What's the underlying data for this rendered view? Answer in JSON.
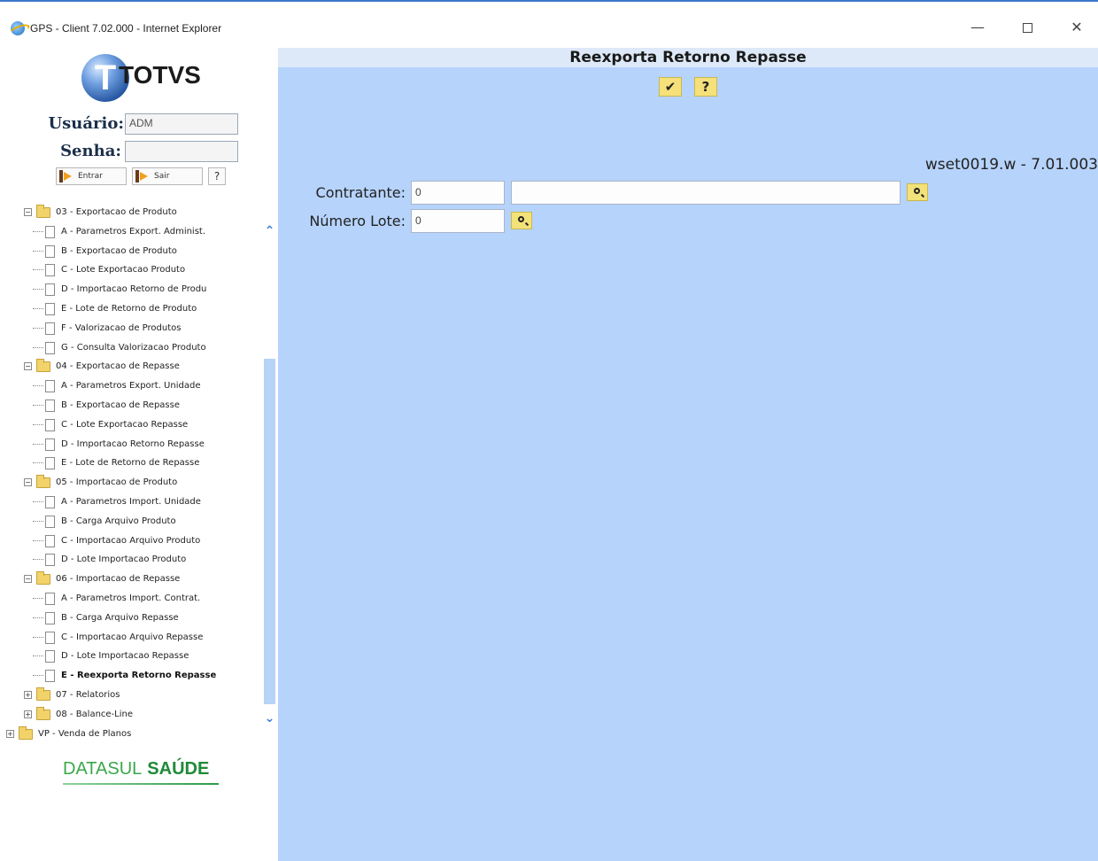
{
  "window": {
    "title": "GPS - Client 7.02.000 - Internet Explorer",
    "minimize": "—",
    "close": "✕"
  },
  "sidebar": {
    "logo_text": "TOTVS",
    "logo_letter": "T",
    "user_label": "Usuário:",
    "user_value": "ADM",
    "password_label": "Senha:",
    "password_value": "",
    "enter_label": "Entrar",
    "exit_label": "Sair",
    "help_label": "?",
    "tree": [
      {
        "indent": 1,
        "type": "folder",
        "expander": "−",
        "label": "03 - Exportacao de Produto",
        "bold": false
      },
      {
        "indent": 2,
        "type": "doc",
        "label": "A - Parametros Export. Administ.",
        "bold": false
      },
      {
        "indent": 2,
        "type": "doc",
        "label": "B - Exportacao de Produto",
        "bold": false
      },
      {
        "indent": 2,
        "type": "doc",
        "label": "C - Lote Exportacao Produto",
        "bold": false
      },
      {
        "indent": 2,
        "type": "doc",
        "label": "D - Importacao Retorno de Produ",
        "bold": false
      },
      {
        "indent": 2,
        "type": "doc",
        "label": "E - Lote de Retorno de Produto",
        "bold": false
      },
      {
        "indent": 2,
        "type": "doc",
        "label": "F - Valorizacao de Produtos",
        "bold": false
      },
      {
        "indent": 2,
        "type": "doc",
        "label": "G - Consulta Valorizacao Produto",
        "bold": false
      },
      {
        "indent": 1,
        "type": "folder",
        "expander": "−",
        "label": "04 - Exportacao de Repasse",
        "bold": false
      },
      {
        "indent": 2,
        "type": "doc",
        "label": "A - Parametros Export. Unidade",
        "bold": false
      },
      {
        "indent": 2,
        "type": "doc",
        "label": "B - Exportacao de Repasse",
        "bold": false
      },
      {
        "indent": 2,
        "type": "doc",
        "label": "C - Lote Exportacao Repasse",
        "bold": false
      },
      {
        "indent": 2,
        "type": "doc",
        "label": "D - Importacao Retorno Repasse",
        "bold": false
      },
      {
        "indent": 2,
        "type": "doc",
        "label": "E - Lote de Retorno de Repasse",
        "bold": false
      },
      {
        "indent": 1,
        "type": "folder",
        "expander": "−",
        "label": "05 - Importacao de Produto",
        "bold": false
      },
      {
        "indent": 2,
        "type": "doc",
        "label": "A - Parametros Import. Unidade",
        "bold": false
      },
      {
        "indent": 2,
        "type": "doc",
        "label": "B - Carga Arquivo Produto",
        "bold": false
      },
      {
        "indent": 2,
        "type": "doc",
        "label": "C - Importacao Arquivo Produto",
        "bold": false
      },
      {
        "indent": 2,
        "type": "doc",
        "label": "D - Lote Importacao Produto",
        "bold": false
      },
      {
        "indent": 1,
        "type": "folder",
        "expander": "−",
        "label": "06 - Importacao de Repasse",
        "bold": false
      },
      {
        "indent": 2,
        "type": "doc",
        "label": "A - Parametros Import. Contrat.",
        "bold": false
      },
      {
        "indent": 2,
        "type": "doc",
        "label": "B - Carga Arquivo Repasse",
        "bold": false
      },
      {
        "indent": 2,
        "type": "doc",
        "label": "C - Importacao Arquivo Repasse",
        "bold": false
      },
      {
        "indent": 2,
        "type": "doc",
        "label": "D - Lote Importacao Repasse",
        "bold": false
      },
      {
        "indent": 2,
        "type": "doc",
        "label": "E - Reexporta Retorno Repasse",
        "bold": true
      },
      {
        "indent": 1,
        "type": "folder",
        "expander": "+",
        "label": "07 - Relatorios",
        "bold": false
      },
      {
        "indent": 1,
        "type": "folder",
        "expander": "+",
        "label": "08 - Balance-Line",
        "bold": false
      },
      {
        "indent": 0,
        "type": "folder",
        "expander": "+",
        "label": "VP - Venda de Planos",
        "bold": false
      }
    ],
    "brand_left": "DATASUL",
    "brand_right": "SAÚDE"
  },
  "main": {
    "page_title": "Reexporta Retorno Repasse",
    "confirm_icon": "✔",
    "help_icon": "?",
    "version": "wset0019.w - 7.01.003",
    "contratante_label": "Contratante:",
    "contratante_value": "0",
    "contratante_name": "",
    "lote_label": "Número Lote:",
    "lote_value": "0"
  }
}
